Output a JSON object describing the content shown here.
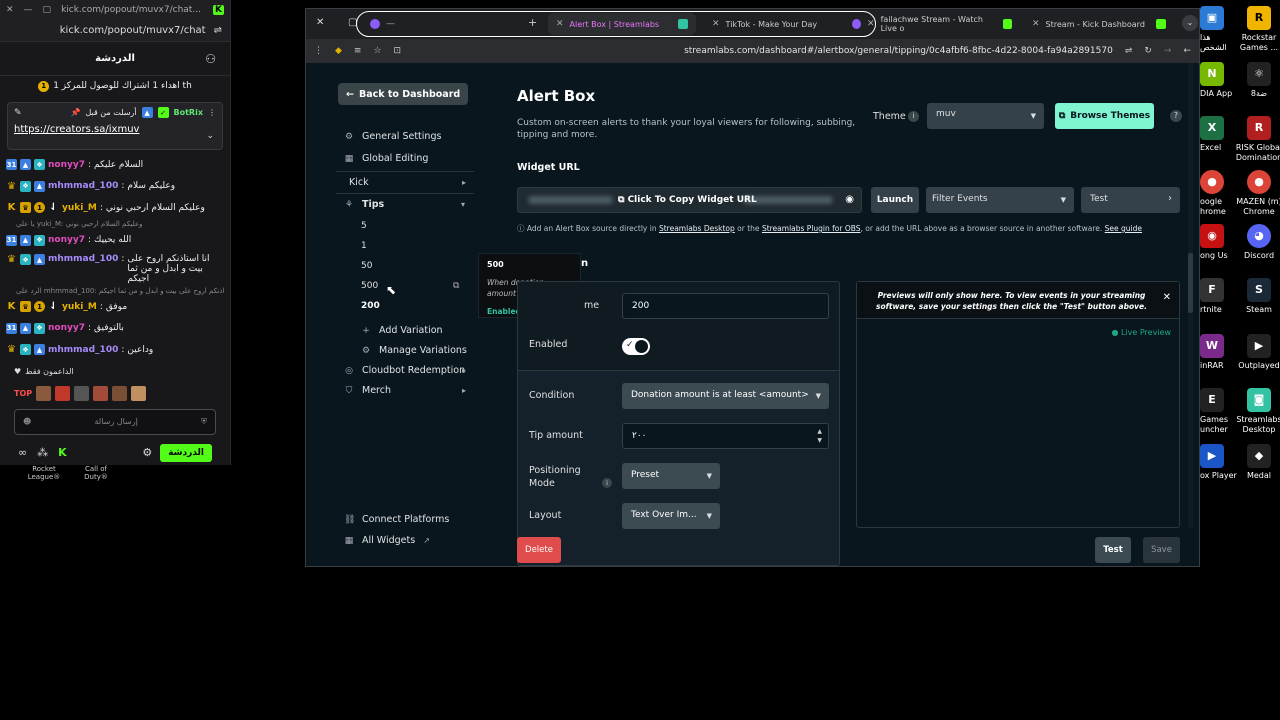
{
  "popout": {
    "titlebar_url": "kick.com/popout/muvx7/chat...",
    "address": "kick.com/popout/muvx7/chat",
    "header_title": "الدردشة",
    "goal_text": "اهداء 1 اشتراك للوصول للمركز 1 th",
    "goal_coin": "1",
    "pinned_by": "أرسلت من قبل",
    "pinned_user": "BotRix",
    "pinned_link": "https://creators.sa/ixmuv",
    "messages": [
      {
        "user": "nonyy7",
        "color": "#e04dbd",
        "text": "السلام عليكم",
        "badges": [
          "31",
          "blue",
          "teal"
        ]
      },
      {
        "user": "mhmmad_100",
        "color": "#a78bfa",
        "text": "وعليكم سلام",
        "badges": [
          "crown",
          "teal",
          "blue"
        ]
      },
      {
        "user": "yuki_M",
        "color": "#e5b100",
        "text": "وعليكم السلام ارحبي نوني",
        "badges": [
          "k",
          "gold",
          "coin",
          "drop"
        ]
      },
      {
        "reply": "يا‌ علي yuki_M: وعليكم السلام ارحبي نوني"
      },
      {
        "user": "nonyy7",
        "color": "#e04dbd",
        "text": "الله يحييك",
        "badges": [
          "31",
          "blue",
          "teal"
        ]
      },
      {
        "user": "mhmmad_100",
        "color": "#a78bfa",
        "text": "انا استاذنكم اروح على بيت و ابدل و من ثما اجيكم",
        "badges": [
          "crown",
          "teal",
          "blue"
        ],
        "tall": true
      },
      {
        "reply": "الرد على mhmmad_100: انا استاذنكم اروح على بيت و ابدل و من ثما اجيكم"
      },
      {
        "user": "yuki_M",
        "color": "#e5b100",
        "text": "موفق",
        "badges": [
          "k",
          "gold",
          "coin",
          "drop"
        ]
      },
      {
        "user": "nonyy7",
        "color": "#e04dbd",
        "text": "بالتوفيق",
        "badges": [
          "31",
          "blue",
          "teal"
        ]
      },
      {
        "user": "mhmmad_100",
        "color": "#a78bfa",
        "text": "وداعين",
        "badges": [
          "crown",
          "teal",
          "blue"
        ]
      }
    ],
    "supporters_label": "الداعمون فقط",
    "top_label": "TOP",
    "input_placeholder": "إرسال رسالة",
    "chat_button": "الدردشة",
    "below_left": "Rocket League®",
    "below_right": "Call of Duty®"
  },
  "browser": {
    "tabs": [
      {
        "label": "",
        "active": false
      },
      {
        "label": "Alert Box | Streamlabs",
        "active": true
      },
      {
        "label": "TikTok - Make Your Day",
        "active": false
      },
      {
        "label": "failachwe Stream - Watch Live o",
        "active": false
      },
      {
        "label": "Stream - Kick Dashboard",
        "active": false
      }
    ],
    "url": "streamlabs.com/dashboard#/alertbox/general/tipping/0c4afbf6-8fbc-4d22-8004-fa94a2891570"
  },
  "sidebar": {
    "back_label": "Back to Dashboard",
    "general_settings": "General Settings",
    "global_editing": "Global Editing",
    "kick": "Kick",
    "tips": "Tips",
    "variations": [
      "5",
      "1",
      "50",
      "500",
      "200"
    ],
    "add_variation": "Add Variation",
    "manage_variations": "Manage Variations",
    "cloudbot": "Cloudbot Redemption",
    "merch": "Merch",
    "connect_platforms": "Connect Platforms",
    "all_widgets": "All Widgets"
  },
  "tooltip": {
    "title": "500",
    "desc": "When donation amount is at least 500",
    "status": "Enabled"
  },
  "content": {
    "title": "Alert Box",
    "subtitle": "Custom on-screen alerts to thank your loyal viewers for following, subbing, tipping and more.",
    "theme_label": "Theme",
    "theme_value": "muv",
    "browse_themes": "Browse Themes",
    "widget_url_label": "Widget URL",
    "copy_widget_url": "Click To Copy Widget URL",
    "launch": "Launch",
    "filter_events": "Filter Events",
    "test_dropdown": "Test",
    "note_prefix": "Add an Alert Box source directly in",
    "note_link1": "Streamlabs Desktop",
    "note_or": "or the",
    "note_link2": "Streamlabs Plugin for OBS",
    "note_suffix": ", or add the URL above as a browser source in another software.",
    "note_guide": "See guide",
    "section_tail": "n",
    "form": {
      "name_label": "me",
      "name_value": "200",
      "enabled_label": "Enabled",
      "condition_label": "Condition",
      "condition_value": "Donation amount is at least <amount>",
      "tip_label": "Tip amount",
      "tip_value": "٢٠٠",
      "positioning_label": "Positioning Mode",
      "positioning_value": "Preset",
      "layout_label": "Layout",
      "layout_value": "Text Over Im..."
    },
    "preview_note": "Previews will only show here. To view events in your streaming software, save your settings then click the \"Test\" button above.",
    "live_preview": "Live Preview",
    "delete": "Delete",
    "test": "Test",
    "save": "Save"
  },
  "desktop": {
    "icons": [
      {
        "label": "هذا الشخص",
        "color": "#2b7bd6"
      },
      {
        "label": "Rockstar Games ...",
        "color": "#f0b400"
      },
      {
        "label": "DIA App",
        "color": "#76b900"
      },
      {
        "label": "8ضة",
        "color": "#222"
      },
      {
        "label": "Excel",
        "color": "#1d7044"
      },
      {
        "label": "RISK Global Domination",
        "color": "#b02020"
      },
      {
        "label": "oogle hrome",
        "color": "#fff"
      },
      {
        "label": "MAZEN (m) Chrome",
        "color": "#fff"
      },
      {
        "label": "ong Us",
        "color": "#c51111"
      },
      {
        "label": "Discord",
        "color": "#5865f2"
      },
      {
        "label": "rtnite",
        "color": "#fff"
      },
      {
        "label": "Steam",
        "color": "#1b2838"
      },
      {
        "label": "inRAR",
        "color": "#7a2a8a"
      },
      {
        "label": "Outplayed",
        "color": "#fff"
      },
      {
        "label": "Games uncher",
        "color": "#222"
      },
      {
        "label": "Streamlabs Desktop",
        "color": "#31c3a2"
      },
      {
        "label": "ox Player",
        "color": "#1a56c8"
      },
      {
        "label": "Medal",
        "color": "#222"
      }
    ]
  }
}
